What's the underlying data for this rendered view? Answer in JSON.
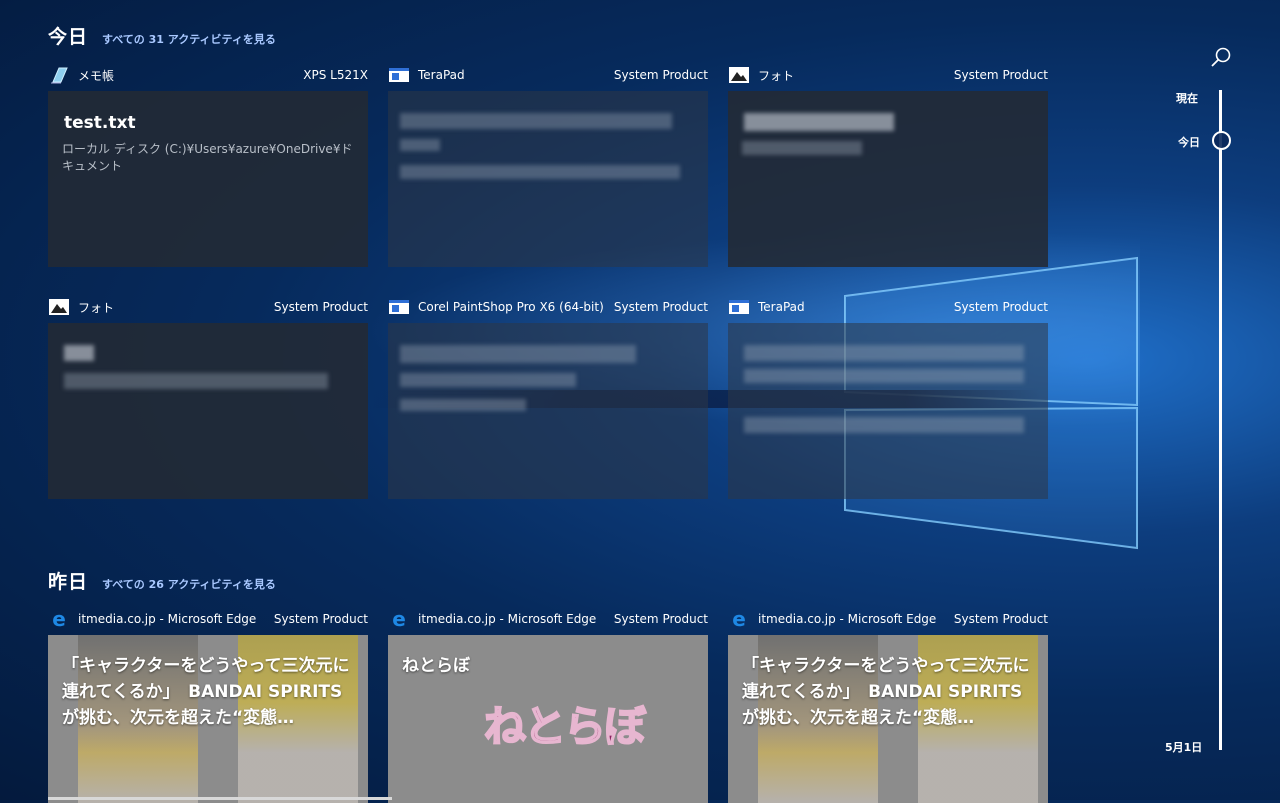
{
  "sections": {
    "today": {
      "title": "今日",
      "see_all": "すべての 31 アクティビティを見る",
      "cards": [
        {
          "app": "メモ帳",
          "device": "XPS L521X",
          "icon": "notepad-icon",
          "doc_title": "test.txt",
          "doc_path": "ローカル ディスク (C:)¥Users¥azure¥OneDrive¥ドキュメント"
        },
        {
          "app": "TeraPad",
          "device": "System Product",
          "icon": "terapad-icon"
        },
        {
          "app": "フォト",
          "device": "System Product",
          "icon": "photos-icon"
        },
        {
          "app": "フォト",
          "device": "System Product",
          "icon": "photos-icon"
        },
        {
          "app": "Corel PaintShop Pro X6 (64-bit)",
          "device": "System Product",
          "icon": "paintshop-icon"
        },
        {
          "app": "TeraPad",
          "device": "System Product",
          "icon": "terapad-icon"
        }
      ]
    },
    "yesterday": {
      "title": "昨日",
      "see_all": "すべての 26 アクティビティを見る",
      "cards": [
        {
          "app": "itmedia.co.jp - Microsoft Edge",
          "device": "System Product",
          "icon": "edge-icon",
          "title": "「キャラクターをどうやって三次元に連れてくるか」　BANDAI SPIRITSが挑む、次元を超えた“変態…"
        },
        {
          "app": "itmedia.co.jp - Microsoft Edge",
          "device": "System Product",
          "icon": "edge-icon",
          "title": "ねとらぼ",
          "logo": "ねとらぼ"
        },
        {
          "app": "itmedia.co.jp - Microsoft Edge",
          "device": "System Product",
          "icon": "edge-icon",
          "title": "「キャラクターをどうやって三次元に連れてくるか」　BANDAI SPIRITSが挑む、次元を超えた“変態…"
        }
      ]
    }
  },
  "timeline": {
    "now": "現在",
    "today": "今日",
    "date": "5月1日"
  },
  "colors": {
    "accent_link": "#a9c8ff",
    "edge_blue": "#1e88e5"
  }
}
